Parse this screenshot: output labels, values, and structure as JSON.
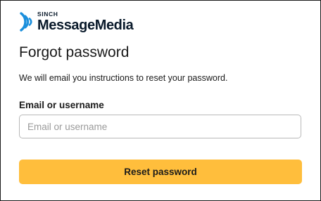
{
  "logo": {
    "top_text": "SINCH",
    "brand_name": "MessageMedia",
    "icon": "sinch-wave-icon",
    "icon_color": "#1b8fdc"
  },
  "form": {
    "title": "Forgot password",
    "description": "We will email you instructions to reset your password.",
    "field_label": "Email or username",
    "field_value": "",
    "field_placeholder": "Email or username",
    "submit_label": "Reset password"
  },
  "colors": {
    "accent": "#ffbe3c",
    "text": "#1a1a1a",
    "border": "#b8b8b8",
    "brand_dark": "#0a1a2b"
  }
}
